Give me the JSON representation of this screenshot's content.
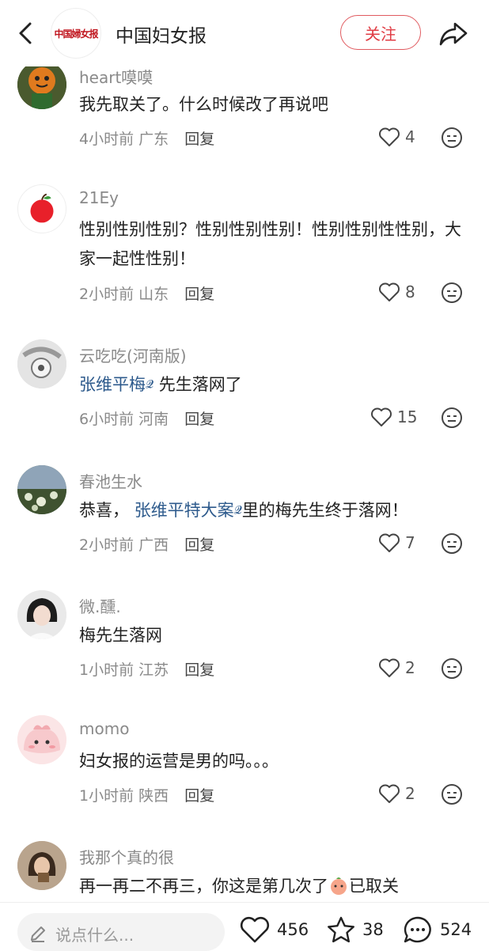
{
  "header": {
    "back_icon": "chevron-left-icon",
    "logo_text": "中国婦女报",
    "title": "中国妇女报",
    "follow_label": "关注",
    "share_icon": "share-icon"
  },
  "comments": [
    {
      "user": "heart嗼嗼",
      "text": "我先取关了。什么时候改了再说吧",
      "time": "4小时前",
      "location": "广东",
      "reply": "回复",
      "likes": "4"
    },
    {
      "user": "21Ey",
      "text": "性别性别性别？性别性别性别！性别性别性性别，大家一起性性别！",
      "time": "2小时前",
      "location": "山东",
      "reply": "回复",
      "likes": "8"
    },
    {
      "user": "云吃吃(河南版)",
      "mention": "张维平梅",
      "text_after": "先生落网了",
      "time": "6小时前",
      "location": "河南",
      "reply": "回复",
      "likes": "15"
    },
    {
      "user": "春池生水",
      "text_before": "恭喜，",
      "mention": "张维平特大案",
      "text_after": "里的梅先生终于落网！",
      "time": "2小时前",
      "location": "广西",
      "reply": "回复",
      "likes": "7"
    },
    {
      "user": "微.醺.",
      "text": "梅先生落网",
      "time": "1小时前",
      "location": "江苏",
      "reply": "回复",
      "likes": "2"
    },
    {
      "user": "momo",
      "text": "妇女报的运营是男的吗。。。",
      "time": "1小时前",
      "location": "陕西",
      "reply": "回复",
      "likes": "2"
    },
    {
      "user": "我那个真的很",
      "text_before": "再一再二不再三，你这是第几次了",
      "text_after": "已取关"
    }
  ],
  "bottom": {
    "input_placeholder": "说点什么...",
    "likes": "456",
    "favorites": "38",
    "comments": "524"
  },
  "colors": {
    "accent": "#e03b43",
    "mention": "#2d5a8c",
    "muted": "#8a8a8a"
  }
}
